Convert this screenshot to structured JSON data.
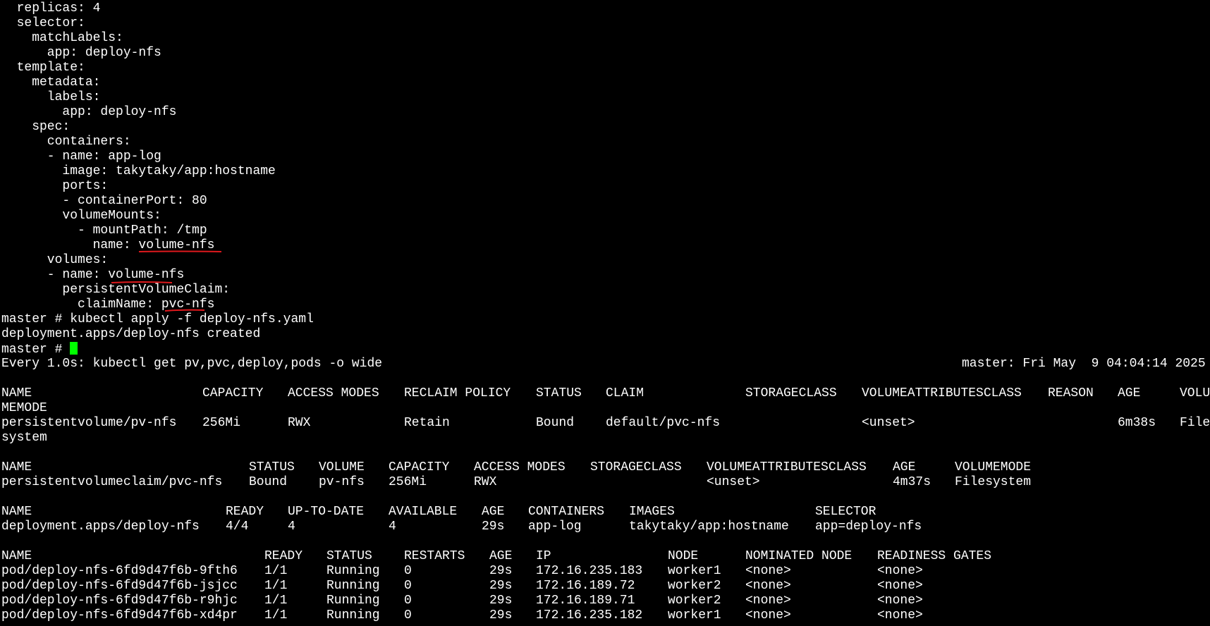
{
  "yaml": [
    "  replicas: 4",
    "  selector:",
    "    matchLabels:",
    "      app: deploy-nfs",
    "  template:",
    "    metadata:",
    "      labels:",
    "        app: deploy-nfs",
    "    spec:",
    "      containers:",
    "      - name: app-log",
    "        image: takytaky/app:hostname",
    "        ports:",
    "        - containerPort: 80",
    "        volumeMounts:",
    "          - mountPath: /tmp",
    "            name: volume-nfs",
    "      volumes:",
    "      - name: volume-nfs",
    "        persistentVolumeClaim:",
    "          claimName: pvc-nfs"
  ],
  "commands": {
    "apply": "master # kubectl apply -f deploy-nfs.yaml",
    "apply_output": "deployment.apps/deploy-nfs created",
    "prompt": "master # "
  },
  "watch": {
    "header_left": "Every 1.0s: kubectl get pv,pvc,deploy,pods -o wide",
    "header_right": "master: Fri May  9 04:04:14 2025"
  },
  "pv": {
    "headers": [
      "NAME",
      "CAPACITY",
      "ACCESS MODES",
      "RECLAIM POLICY",
      "STATUS",
      "CLAIM",
      "STORAGECLASS",
      "VOLUMEATTRIBUTESCLASS",
      "REASON",
      "AGE",
      "VOLU"
    ],
    "header_wrap": "MEMODE",
    "row": [
      "persistentvolume/pv-nfs",
      "256Mi",
      "RWX",
      "Retain",
      "Bound",
      "default/pvc-nfs",
      "",
      "<unset>",
      "",
      "6m38s",
      "File"
    ],
    "row_wrap": "system"
  },
  "pvc": {
    "headers": [
      "NAME",
      "STATUS",
      "VOLUME",
      "CAPACITY",
      "ACCESS MODES",
      "STORAGECLASS",
      "VOLUMEATTRIBUTESCLASS",
      "AGE",
      "VOLUMEMODE"
    ],
    "row": [
      "persistentvolumeclaim/pvc-nfs",
      "Bound",
      "pv-nfs",
      "256Mi",
      "RWX",
      "",
      "<unset>",
      "4m37s",
      "Filesystem"
    ]
  },
  "deploy": {
    "headers": [
      "NAME",
      "READY",
      "UP-TO-DATE",
      "AVAILABLE",
      "AGE",
      "CONTAINERS",
      "IMAGES",
      "SELECTOR"
    ],
    "row": [
      "deployment.apps/deploy-nfs",
      "4/4",
      "4",
      "4",
      "29s",
      "app-log",
      "takytaky/app:hostname",
      "app=deploy-nfs"
    ]
  },
  "pods": {
    "headers": [
      "NAME",
      "READY",
      "STATUS",
      "RESTARTS",
      "AGE",
      "IP",
      "NODE",
      "NOMINATED NODE",
      "READINESS GATES"
    ],
    "rows": [
      [
        "pod/deploy-nfs-6fd9d47f6b-9fth6",
        "1/1",
        "Running",
        "0",
        "29s",
        "172.16.235.183",
        "worker1",
        "<none>",
        "<none>"
      ],
      [
        "pod/deploy-nfs-6fd9d47f6b-jsjcc",
        "1/1",
        "Running",
        "0",
        "29s",
        "172.16.189.72",
        "worker2",
        "<none>",
        "<none>"
      ],
      [
        "pod/deploy-nfs-6fd9d47f6b-r9hjc",
        "1/1",
        "Running",
        "0",
        "29s",
        "172.16.189.71",
        "worker2",
        "<none>",
        "<none>"
      ],
      [
        "pod/deploy-nfs-6fd9d47f6b-xd4pr",
        "1/1",
        "Running",
        "0",
        "29s",
        "172.16.235.182",
        "worker1",
        "<none>",
        "<none>"
      ]
    ]
  },
  "colors": {
    "background": "#000000",
    "text": "#ffffff",
    "cursor": "#00ff00",
    "annotation": "#e0191d"
  }
}
